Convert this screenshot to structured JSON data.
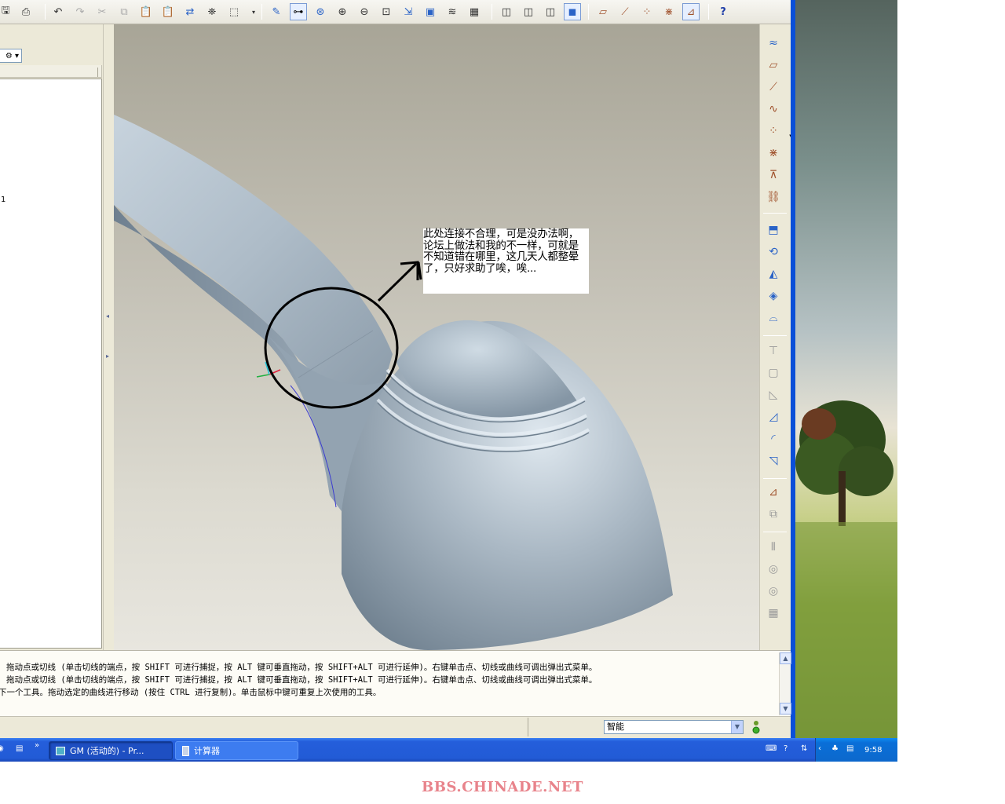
{
  "toolbar": {
    "buttons": [
      "save-icon",
      "print-icon",
      "undo-icon",
      "redo-icon",
      "cut-icon",
      "copy-icon",
      "paste-icon",
      "paste-special-icon",
      "regenerate-icon",
      "find-icon",
      "select-box-icon",
      "sketch-icon",
      "datum-display-icon",
      "spin-center-icon",
      "zoom-in-icon",
      "zoom-out-icon",
      "refit-icon",
      "orient-icon",
      "saved-views-icon",
      "layers-icon",
      "view-manager-icon",
      "wireframe-icon",
      "hidden-line-icon",
      "no-hidden-icon",
      "shading-icon",
      "datum-plane-icon",
      "datum-axis-icon",
      "datum-point-icon",
      "coordinate-system-icon",
      "annotation-icon",
      "context-help-icon"
    ]
  },
  "navigator": {
    "dropdown_glyph": "⚙",
    "tree_item": "1"
  },
  "callout": {
    "text": "此处连接不合理，可是没办法啊，论坛上做法和我的不一样，可就是不知道错在哪里，这几天人都整晕了，只好求助了唉，唉..."
  },
  "messages": [
    "拖动点或切线 (单击切线的端点，按 SHIFT 可进行捕捉，按 ALT 键可垂直拖动，按 SHIFT+ALT 可进行延伸)。右键单击点、切线或曲线可调出弹出式菜单。",
    "拖动点或切线 (单击切线的端点，按 SHIFT 可进行捕捉，按 ALT 键可垂直拖动，按 SHIFT+ALT 可进行延伸)。右键单击点、切线或曲线可调出弹出式菜单。",
    "下一个工具。拖动选定的曲线进行移动 (按住 CTRL 进行复制)。单击鼠标中键可重复上次使用的工具。"
  ],
  "status": {
    "filter_value": "智能"
  },
  "taskbar": {
    "quicklaunch_more": "»",
    "tasks": [
      {
        "label": "GM (活动的) - Pr..."
      },
      {
        "label": "计算器"
      }
    ],
    "clock": "9:58"
  },
  "watermark": "BBS.CHINADE.NET",
  "colors": {
    "model_surface": "#a9b6c1",
    "viewport_top": "#a8a597",
    "viewport_bottom": "#e8e6df",
    "taskbar_blue": "#245edb",
    "watermark": "#e8838b"
  }
}
